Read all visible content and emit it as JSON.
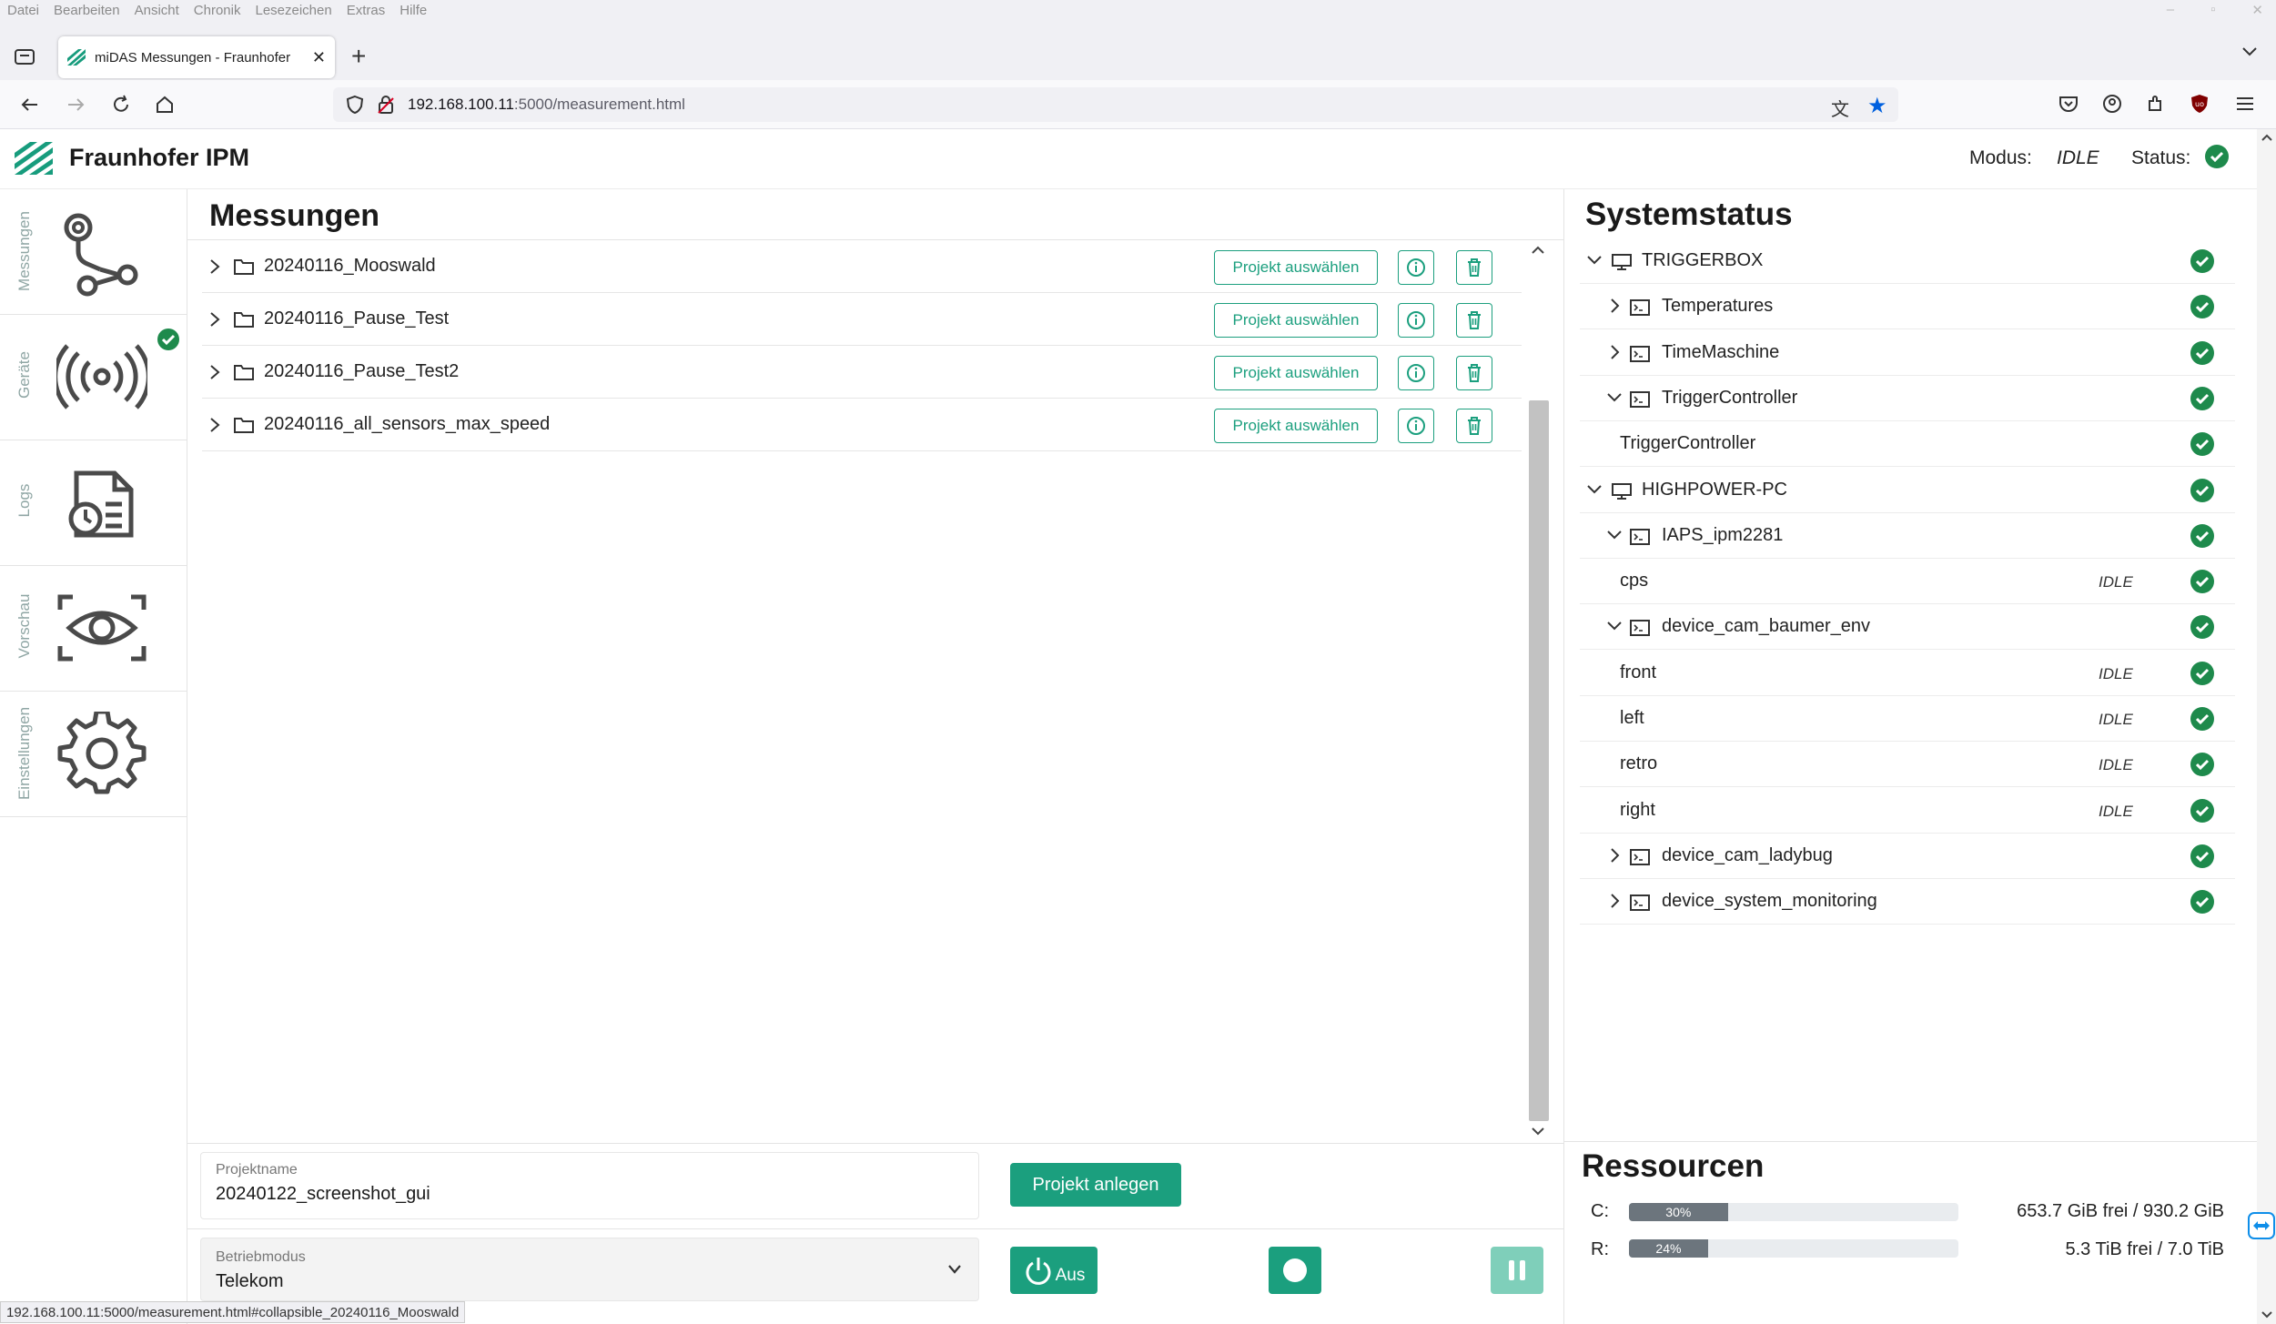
{
  "browser": {
    "menu": [
      "Datei",
      "Bearbeiten",
      "Ansicht",
      "Chronik",
      "Lesezeichen",
      "Extras",
      "Hilfe"
    ],
    "tab_title": "miDAS Messungen - Fraunhofer",
    "url_host": "192.168.100.11",
    "url_path": ":5000/measurement.html",
    "status_url": "192.168.100.11:5000/measurement.html#collapsible_20240116_Mooswald"
  },
  "header": {
    "brand": "Fraunhofer IPM",
    "modus_label": "Modus:",
    "modus_value": "IDLE",
    "status_label": "Status:"
  },
  "sidebar": {
    "items": [
      {
        "label": "Messungen",
        "icon": "route-icon"
      },
      {
        "label": "Geräte",
        "icon": "broadcast-icon"
      },
      {
        "label": "Logs",
        "icon": "log-file-icon"
      },
      {
        "label": "Vorschau",
        "icon": "eye-icon"
      },
      {
        "label": "Einstellungen",
        "icon": "gear-icon"
      }
    ]
  },
  "measurements": {
    "title": "Messungen",
    "select_label": "Projekt auswählen",
    "rows": [
      {
        "name": "20240116_Mooswald"
      },
      {
        "name": "20240116_Pause_Test"
      },
      {
        "name": "20240116_Pause_Test2"
      },
      {
        "name": "20240116_all_sensors_max_speed"
      }
    ]
  },
  "controls": {
    "projektname_label": "Projektname",
    "projektname_value": "20240122_screenshot_gui",
    "create_label": "Projekt anlegen",
    "betriebmodus_label": "Betriebmodus",
    "betriebmodus_value": "Telekom",
    "power_label": "Aus"
  },
  "systemstatus": {
    "title": "Systemstatus",
    "rows": [
      {
        "name": "TRIGGERBOX",
        "state": ""
      },
      {
        "name": "Temperatures",
        "state": ""
      },
      {
        "name": "TimeMaschine",
        "state": ""
      },
      {
        "name": "TriggerController",
        "state": ""
      },
      {
        "name": "TriggerController",
        "state": ""
      },
      {
        "name": "HIGHPOWER-PC",
        "state": ""
      },
      {
        "name": "IAPS_ipm2281",
        "state": ""
      },
      {
        "name": "cps",
        "state": "IDLE"
      },
      {
        "name": "device_cam_baumer_env",
        "state": ""
      },
      {
        "name": "front",
        "state": "IDLE"
      },
      {
        "name": "left",
        "state": "IDLE"
      },
      {
        "name": "retro",
        "state": "IDLE"
      },
      {
        "name": "right",
        "state": "IDLE"
      },
      {
        "name": "device_cam_ladybug",
        "state": ""
      },
      {
        "name": "device_system_monitoring",
        "state": ""
      }
    ]
  },
  "resources": {
    "title": "Ressourcen",
    "drives": [
      {
        "label": "C:",
        "percent": "30%",
        "usage": 0.3,
        "free": "653.7 GiB frei / 930.2 GiB"
      },
      {
        "label": "R:",
        "percent": "24%",
        "usage": 0.24,
        "free": "5.3 TiB frei / 7.0 TiB"
      }
    ]
  },
  "colors": {
    "accent": "#1b9f7e",
    "ok": "#1e8a4c"
  }
}
